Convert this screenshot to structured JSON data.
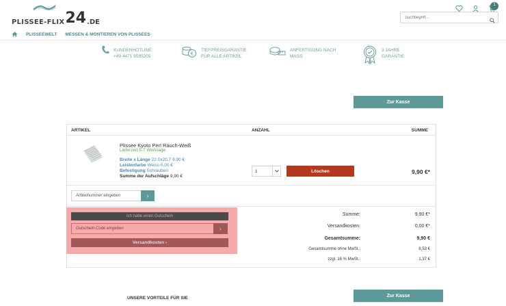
{
  "header": {
    "logo_text_left": "PLISSEE",
    "logo_text_mid": "FLIX",
    "logo_number": "24",
    "logo_domain": ".DE",
    "search_placeholder": "Suchbegriff...",
    "cart_count": "1"
  },
  "nav": {
    "items": [
      {
        "label": "PLISSEEWELT"
      },
      {
        "label": "MESSEN & MONTIEREN VON PLISSEES"
      }
    ]
  },
  "usps": [
    {
      "line1": "KUNDENHOTLINE:",
      "line2": "+49 4471 9585205",
      "icon": "phone-icon"
    },
    {
      "line1": "TIEFPREISGARANTIE",
      "line2": "FÜR ALLE ARTIKEL",
      "icon": "coins-euro-icon"
    },
    {
      "line1": "ANFERTIGUNG NACH",
      "line2": "MASS",
      "icon": "measuring-tape-icon"
    },
    {
      "line1": "3 JAHRE",
      "line2": "GARANTIE",
      "icon": "award-badge-icon"
    }
  ],
  "checkout": {
    "button_label": "Zur Kasse"
  },
  "cart": {
    "col_article": "ARTIKEL",
    "col_qty": "ANZAHL",
    "col_sum": "SUMME",
    "item": {
      "name": "Plissee Kyoto Perl Rauch-Weiß",
      "delivery": "Lieferzeit 5-7 Werktage",
      "attrs": [
        {
          "label": "Breite x Länge",
          "value": "22.0x20.7 9.90 €"
        },
        {
          "label": "Leistenfarbe",
          "value": "Weiss 0,00 €"
        },
        {
          "label": "Befestigung",
          "value": "Schrauben"
        }
      ],
      "surcharge_label": "Summe der Aufschläge",
      "surcharge_value": "9,90 €",
      "quantity": "1",
      "delete_label": "Löschen",
      "price": "9,90 €*"
    },
    "article_number_placeholder": "Artikelnummer eingeben",
    "go_arrow": "›"
  },
  "voucher": {
    "toggle_label": "Ich habe einen Gutschein",
    "input_placeholder": "Gutschein-Code eingeben",
    "shipping_label": "Versandkosten ›"
  },
  "totals": [
    {
      "label": "Summe:",
      "value": "9,90 €*",
      "style": "normal"
    },
    {
      "label": "Versandkosten:",
      "value": "0,00 €*",
      "style": "normal"
    },
    {
      "label": "Gesamtsumme:",
      "value": "9,90 €",
      "style": "bold"
    },
    {
      "label": "Gesamtsumme ohne MwSt.:",
      "value": "8,53 €",
      "style": "small"
    },
    {
      "label": "zzgl. 16 % MwSt.:",
      "value": "1,37 €",
      "style": "small"
    }
  ],
  "footer": {
    "vorteile": "UNSERE VORTEILE FÜR SIE"
  },
  "colors": {
    "accent": "#5e9999",
    "danger": "#b4391f",
    "highlight": "#f7aaaa"
  }
}
